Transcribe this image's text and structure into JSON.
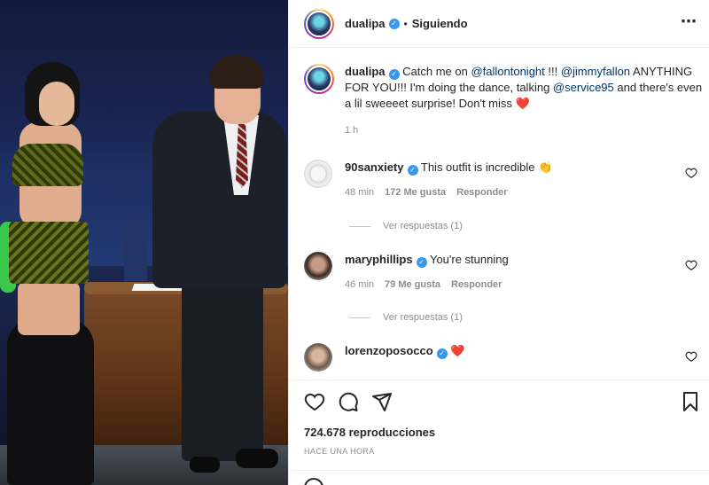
{
  "post": {
    "username": "dualipa",
    "separator": "•",
    "follow_status": "Siguiendo",
    "more_icon": "⋯"
  },
  "caption": {
    "username": "dualipa",
    "text_before": " Catch me on ",
    "mention1": "@fallontonight",
    "text_mid1": " !!! ",
    "mention2": "@jimmyfallon",
    "text_mid2": " ANYTHING FOR YOU!!! I'm doing the dance, talking ",
    "mention3": "@service95",
    "text_after": " and there's even a lil sweeeet surprise! Don't miss ",
    "heart": "❤️",
    "time": "1 h"
  },
  "comments": [
    {
      "username": "90sanxiety",
      "text": "This outfit is incredible 👏",
      "time": "48 min",
      "likes": "172 Me gusta",
      "reply": "Responder",
      "replies": "Ver respuestas (1)"
    },
    {
      "username": "maryphillips",
      "text": "You're stunning",
      "time": "46 min",
      "likes": "79 Me gusta",
      "reply": "Responder",
      "replies": "Ver respuestas (1)"
    },
    {
      "username": "lorenzoposocco",
      "text": "❤️"
    }
  ],
  "stats": {
    "views": "724.678 reproducciones",
    "time_ago": "HACE UNA HORA"
  },
  "colors": {
    "verified": "#3897f0",
    "mention": "#00376b",
    "heart": "#ed4956",
    "muted": "#8e8e8e"
  },
  "icons": [
    "heart-icon",
    "comment-icon",
    "share-icon",
    "bookmark-icon",
    "more-icon",
    "verified-icon"
  ]
}
